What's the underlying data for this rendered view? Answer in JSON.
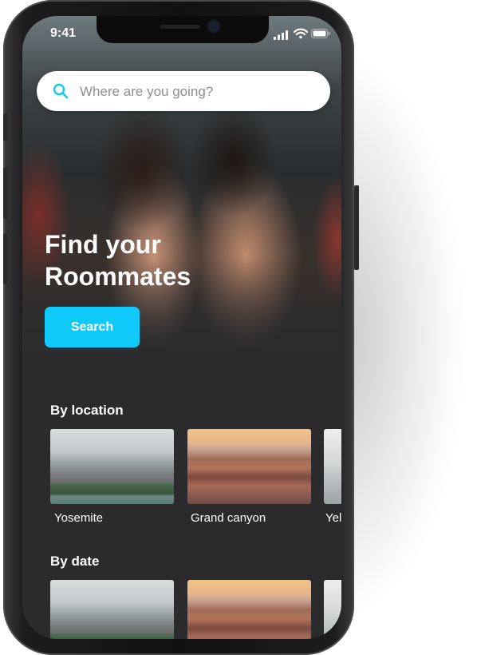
{
  "status_bar": {
    "time": "9:41"
  },
  "search": {
    "placeholder": "Where are you going?"
  },
  "hero": {
    "title_line1": "Find your",
    "title_line2": "Roommates",
    "cta_label": "Search"
  },
  "sections": [
    {
      "title": "By location",
      "cards": [
        {
          "label": "Yosemite"
        },
        {
          "label": "Grand canyon"
        },
        {
          "label": "Yel"
        }
      ]
    },
    {
      "title": "By date",
      "cards": [
        {
          "label": ""
        },
        {
          "label": ""
        },
        {
          "label": ""
        }
      ]
    }
  ],
  "colors": {
    "accent": "#0fc9fa",
    "background": "#2b2b2d",
    "search_icon": "#0fc9fa"
  }
}
